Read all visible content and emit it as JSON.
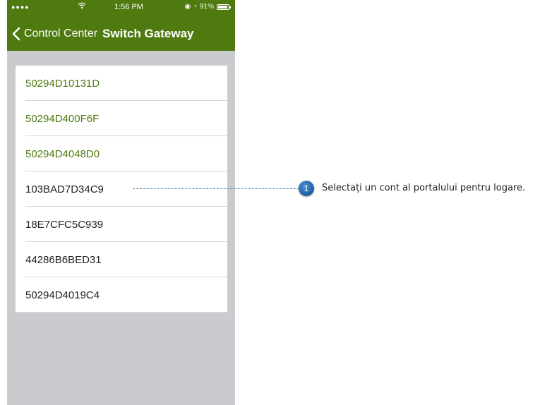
{
  "status_bar": {
    "signal": "●●●●",
    "wifi_icon": "wifi-icon",
    "time": "1:56 PM",
    "indicators": "◉ ◔",
    "battery": "91%",
    "battery_level": 0.91
  },
  "nav": {
    "back_label": "Control Center",
    "title": "Switch Gateway"
  },
  "gateways": [
    {
      "id": "50294D10131D",
      "color": "#4f7a10"
    },
    {
      "id": "50294D400F6F",
      "color": "#4f7a10"
    },
    {
      "id": "50294D4048D0",
      "color": "#4f7a10"
    },
    {
      "id": "103BAD7D34C9",
      "color": "#222222"
    },
    {
      "id": "18E7CFC5C939",
      "color": "#222222"
    },
    {
      "id": "44286B6BED31",
      "color": "#222222"
    },
    {
      "id": "50294D4019C4",
      "color": "#222222"
    }
  ],
  "callout": {
    "number": "1",
    "text": "Selectați un cont al portalului pentru logare."
  },
  "colors": {
    "accent": "#4f7a10",
    "background": "#c9cbcf",
    "callout": "#1d5e9f"
  }
}
